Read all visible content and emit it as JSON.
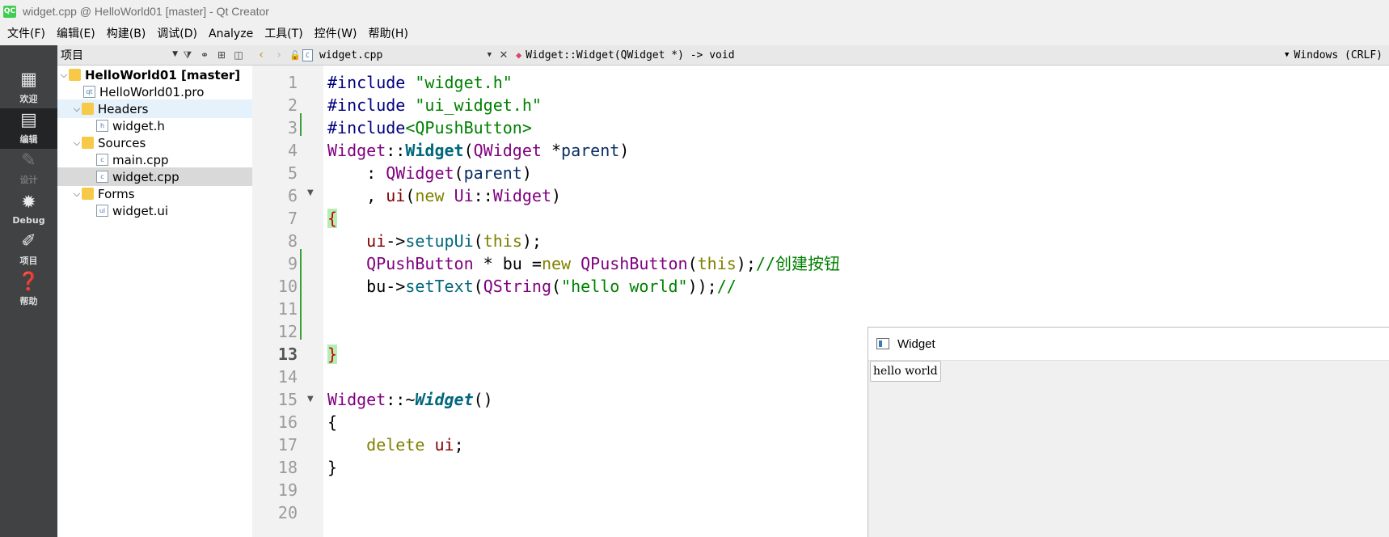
{
  "window": {
    "title": "widget.cpp @ HelloWorld01 [master] - Qt Creator",
    "app_icon": "QC"
  },
  "menu": [
    "文件(F)",
    "编辑(E)",
    "构建(B)",
    "调试(D)",
    "Analyze",
    "工具(T)",
    "控件(W)",
    "帮助(H)"
  ],
  "modes": [
    {
      "icon": "▦",
      "label": "欢迎",
      "icon_name": "grid-icon"
    },
    {
      "icon": "▤",
      "label": "编辑",
      "icon_name": "edit-doc-icon"
    },
    {
      "icon": "✎",
      "label": "设计",
      "icon_name": "pencil-icon"
    },
    {
      "icon": "✹",
      "label": "Debug",
      "icon_name": "bug-icon"
    },
    {
      "icon": "✐",
      "label": "项目",
      "icon_name": "wrench-icon"
    },
    {
      "icon": "❓",
      "label": "帮助",
      "icon_name": "help-icon"
    }
  ],
  "project": {
    "selector": "项目",
    "tree": [
      {
        "label": "HelloWorld01 [master]",
        "level": 0,
        "expand": "⌄",
        "icon": "folder",
        "badge": ""
      },
      {
        "label": "HelloWorld01.pro",
        "level": 1,
        "expand": "",
        "icon": "doc",
        "badge": "qt"
      },
      {
        "label": "Headers",
        "level": 1,
        "expand": "⌄",
        "icon": "folder",
        "badge": "h"
      },
      {
        "label": "widget.h",
        "level": 2,
        "expand": "",
        "icon": "doc",
        "badge": "h"
      },
      {
        "label": "Sources",
        "level": 1,
        "expand": "⌄",
        "icon": "folder",
        "badge": "c"
      },
      {
        "label": "main.cpp",
        "level": 2,
        "expand": "",
        "icon": "doc",
        "badge": "c"
      },
      {
        "label": "widget.cpp",
        "level": 2,
        "expand": "",
        "icon": "doc",
        "badge": "c"
      },
      {
        "label": "Forms",
        "level": 1,
        "expand": "⌄",
        "icon": "folder",
        "badge": ""
      },
      {
        "label": "widget.ui",
        "level": 2,
        "expand": "",
        "icon": "doc",
        "badge": "ui"
      }
    ]
  },
  "editor": {
    "file": "widget.cpp",
    "file_icon": "C",
    "symbol": "Widget::Widget(QWidget *) -> void",
    "line_endings": "Windows (CRLF)",
    "current_line": "13",
    "line_numbers": [
      "1",
      "2",
      "3",
      "4",
      "5",
      "6",
      "7",
      "8",
      "9",
      "10",
      "11",
      "12",
      "13",
      "14",
      "15",
      "16",
      "17",
      "18",
      "19",
      "20"
    ],
    "lines": [
      [
        [
          "pp",
          "#include "
        ],
        [
          "str",
          "\"widget.h\""
        ]
      ],
      [
        [
          "pp",
          "#include "
        ],
        [
          "str",
          "\"ui_widget.h\""
        ]
      ],
      [
        [
          "pp",
          "#include"
        ],
        [
          "str",
          "<QPushButton>"
        ]
      ],
      [
        [
          "ty",
          "Widget"
        ],
        [
          "",
          "::"
        ],
        [
          "fnb",
          "Widget"
        ],
        [
          "",
          "("
        ],
        [
          "ty",
          "QWidget"
        ],
        [
          "",
          " *"
        ],
        [
          "par",
          "parent"
        ],
        [
          "",
          ")"
        ]
      ],
      [
        [
          "",
          "    : "
        ],
        [
          "ty",
          "QWidget"
        ],
        [
          "",
          "("
        ],
        [
          "par",
          "parent"
        ],
        [
          "",
          ")"
        ]
      ],
      [
        [
          "",
          "    , "
        ],
        [
          "mem",
          "ui"
        ],
        [
          "",
          "("
        ],
        [
          "kw",
          "new"
        ],
        [
          "",
          " "
        ],
        [
          "ty",
          "Ui"
        ],
        [
          "",
          "::"
        ],
        [
          "ty",
          "Widget"
        ],
        [
          "",
          ")"
        ]
      ],
      [
        [
          "brace",
          "{"
        ]
      ],
      [
        [
          "",
          "    "
        ],
        [
          "mem",
          "ui"
        ],
        [
          "",
          "->"
        ],
        [
          "fn",
          "setupUi"
        ],
        [
          "",
          "("
        ],
        [
          "kw",
          "this"
        ],
        [
          "",
          ");"
        ]
      ],
      [
        [
          "",
          "    "
        ],
        [
          "ty",
          "QPushButton"
        ],
        [
          "",
          " * "
        ],
        [
          "",
          "bu"
        ],
        [
          "",
          " ="
        ],
        [
          "kw",
          "new"
        ],
        [
          "",
          " "
        ],
        [
          "ty",
          "QPushButton"
        ],
        [
          "",
          "("
        ],
        [
          "kw",
          "this"
        ],
        [
          "",
          ");"
        ],
        [
          "cm",
          "//创建按钮"
        ]
      ],
      [
        [
          "",
          "    "
        ],
        [
          "",
          "bu"
        ],
        [
          "",
          "->"
        ],
        [
          "fn",
          "setText"
        ],
        [
          "",
          "("
        ],
        [
          "ty",
          "QString"
        ],
        [
          "",
          "("
        ],
        [
          "str",
          "\"hello world\""
        ],
        [
          "",
          "));"
        ],
        [
          "cm",
          "//"
        ]
      ],
      [],
      [],
      [
        [
          "brace",
          "}"
        ]
      ],
      [],
      [
        [
          "ty",
          "Widget"
        ],
        [
          "",
          "::~"
        ],
        [
          "fnbi",
          "Widget"
        ],
        [
          "",
          "()"
        ]
      ],
      [
        [
          "",
          "{"
        ]
      ],
      [
        [
          "",
          "    "
        ],
        [
          "kw",
          "delete"
        ],
        [
          "",
          " "
        ],
        [
          "mem",
          "ui"
        ],
        [
          "",
          ";"
        ]
      ],
      [
        [
          "",
          "}"
        ]
      ],
      [],
      []
    ]
  },
  "popup": {
    "title": "Widget",
    "button_label": "hello world"
  },
  "colors": {
    "modebar": "#404244",
    "string": "#008000",
    "keyword": "#808000",
    "type": "#800080"
  }
}
